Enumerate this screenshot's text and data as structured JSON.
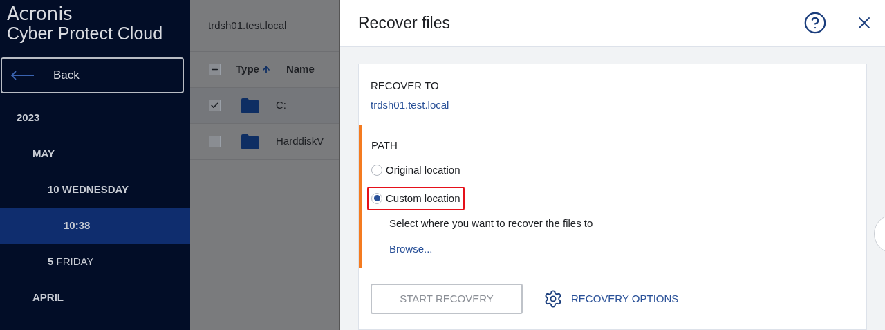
{
  "brand": {
    "line_1": "Acronis",
    "line_2": "Cyber Protect Cloud"
  },
  "back_button": {
    "label": "Back"
  },
  "sidebar": {
    "items": [
      {
        "label": "2023",
        "selected": false,
        "children": [
          {
            "label": "MAY",
            "selected": false,
            "children": [
              {
                "label": "**10** WEDNESDAY",
                "selected": false,
                "children": [
                  {
                    "label": "10:38",
                    "selected": true
                  }
                ]
              },
              {
                "label": "**5** FRIDAY",
                "selected": false
              }
            ]
          },
          {
            "label": "APRIL",
            "selected": false
          }
        ]
      }
    ]
  },
  "browser": {
    "title": "trdsh01.test.local",
    "header": {
      "indeterminate": true,
      "columns": [
        "Type",
        "Name"
      ]
    },
    "rows": [
      {
        "checked": true,
        "name": "C:"
      },
      {
        "checked": false,
        "name": "HarddiskV"
      }
    ]
  },
  "dialog": {
    "title": "Recover files",
    "recover_to": {
      "label": "RECOVER TO",
      "value": "trdsh01.test.local"
    },
    "path": {
      "label": "PATH",
      "options": [
        {
          "label": "Original location",
          "selected": false,
          "highlighted": false
        },
        {
          "label": "Custom location",
          "selected": true,
          "highlighted": true
        }
      ],
      "hint": "Select where you want to recover the files to",
      "browse": "Browse..."
    },
    "start_button": {
      "label": "START RECOVERY",
      "disabled": true
    },
    "options_button": {
      "label": "RECOVERY OPTIONS"
    }
  }
}
